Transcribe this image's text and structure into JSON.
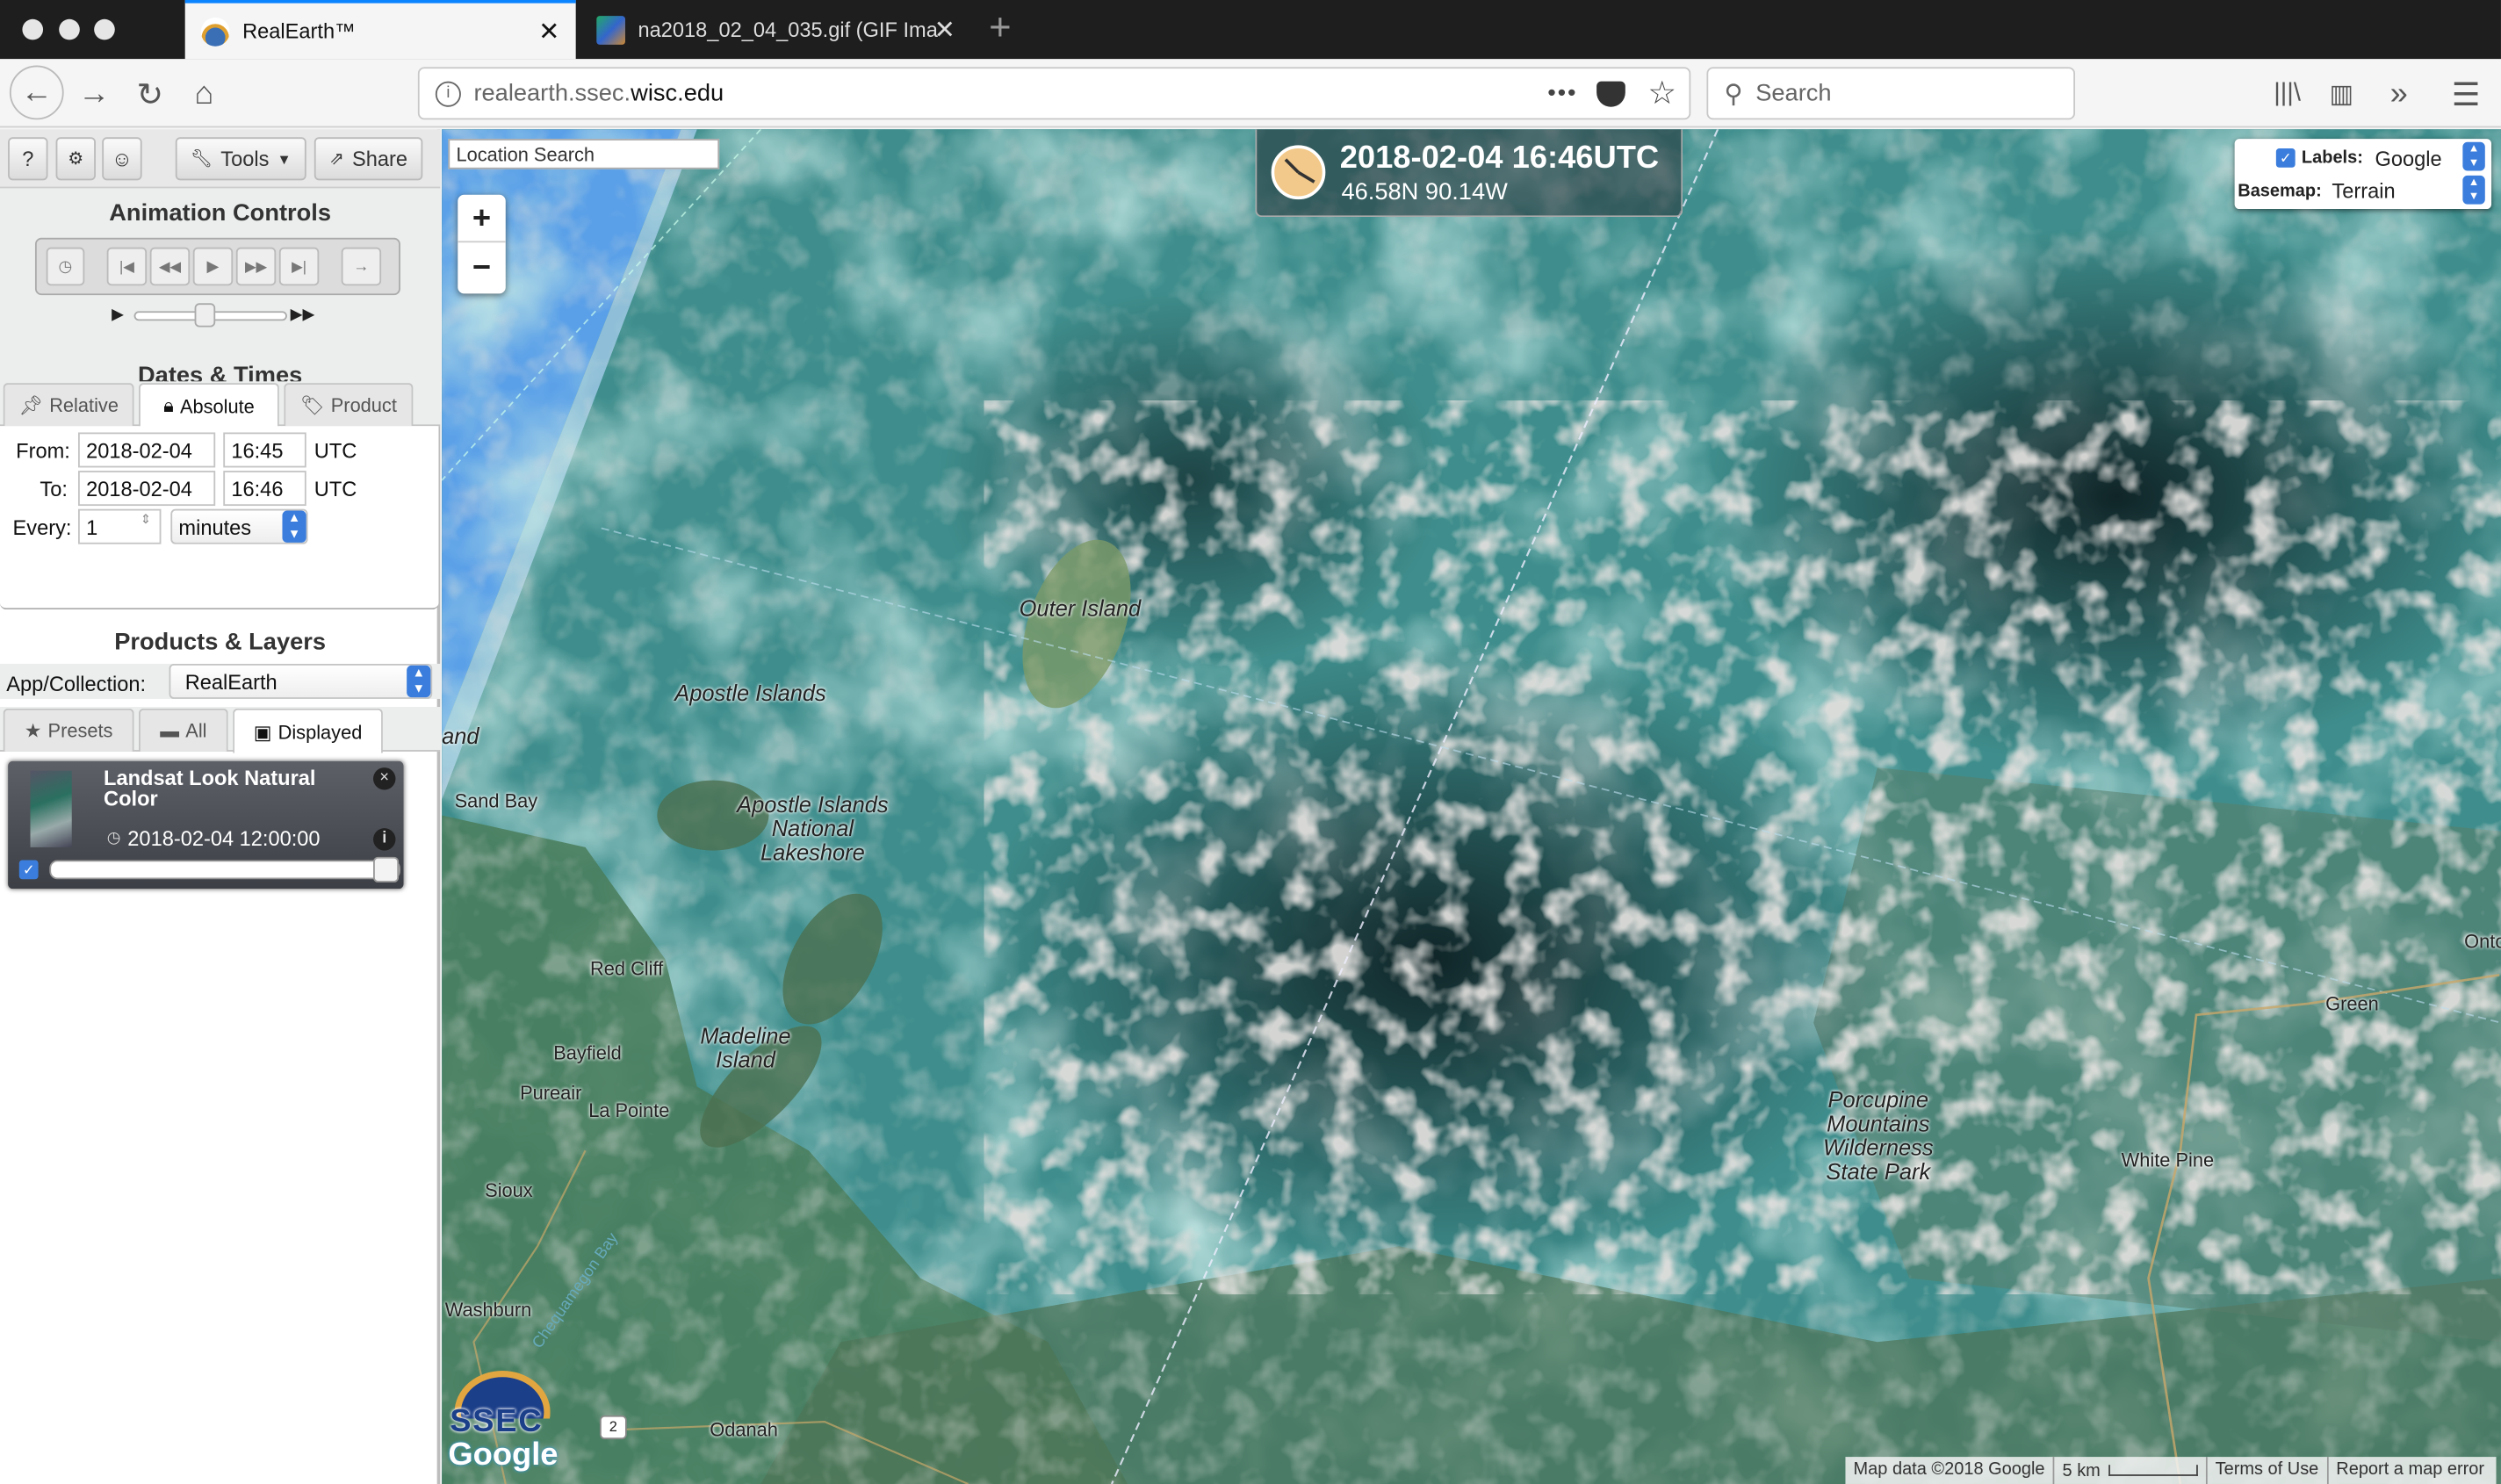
{
  "browser": {
    "tabs": [
      {
        "title": "RealEarth™",
        "close": "✕"
      },
      {
        "title": "na2018_02_04_035.gif (GIF Ima",
        "close": "✕"
      }
    ],
    "new_tab": "+",
    "url_prefix": "realearth.ssec.",
    "url_domain": "wisc.edu",
    "page_actions": "•••",
    "search_placeholder": "Search"
  },
  "sidebar": {
    "toolbar": {
      "help": "?",
      "settings": "⚙",
      "user": "☺",
      "tools": "Tools",
      "share": "Share"
    },
    "animation": {
      "title": "Animation Controls"
    },
    "dates": {
      "title": "Dates & Times",
      "tabs": [
        "Relative",
        "Absolute",
        "Product"
      ],
      "from_label": "From:",
      "from_date": "2018-02-04",
      "from_time": "16:45",
      "to_label": "To:",
      "to_date": "2018-02-04",
      "to_time": "16:46",
      "utc": "UTC",
      "every_label": "Every:",
      "every_value": "1",
      "every_unit": "minutes"
    },
    "products": {
      "title": "Products & Layers",
      "app_label": "App/Collection:",
      "app_value": "RealEarth",
      "tabs": [
        "Presets",
        "All",
        "Displayed"
      ],
      "layer": {
        "name": "Landsat Look Natural Color",
        "time": "2018-02-04 12:00:00",
        "opacity": 1.0
      }
    }
  },
  "map": {
    "location_search_placeholder": "Location Search",
    "zoom_in": "+",
    "zoom_out": "−",
    "clock": {
      "datetime": "2018-02-04 16:46UTC",
      "coords": "46.58N 90.14W"
    },
    "labels_label": "Labels:",
    "labels_value": "Google",
    "basemap_label": "Basemap:",
    "basemap_value": "Terrain",
    "places": {
      "outer_island": "Outer Island",
      "apostle_islands": "Apostle Islands",
      "apostle_nl": [
        "Apostle Islands",
        "National",
        "Lakeshore"
      ],
      "land": "and",
      "sand_bay": "Sand Bay",
      "red_cliff": "Red Cliff",
      "bayfield": "Bayfield",
      "madeline": [
        "Madeline",
        "Island"
      ],
      "pureair": "Pureair",
      "la_pointe": "La Pointe",
      "sioux": "Sioux",
      "washburn": "Washburn",
      "chequamegon": "Chequamegon Bay",
      "odanah": "Odanah",
      "route": "2",
      "porcupine": [
        "Porcupine",
        "Mountains",
        "Wilderness",
        "State Park"
      ],
      "green": "Green",
      "white_pine": "White Pine",
      "onto": "Onto"
    },
    "logo_ssec": "SSEC",
    "logo_google": "Google",
    "footer": {
      "map_data": "Map data ©2018 Google",
      "scale": "5 km",
      "terms": "Terms of Use",
      "report": "Report a map error"
    }
  }
}
